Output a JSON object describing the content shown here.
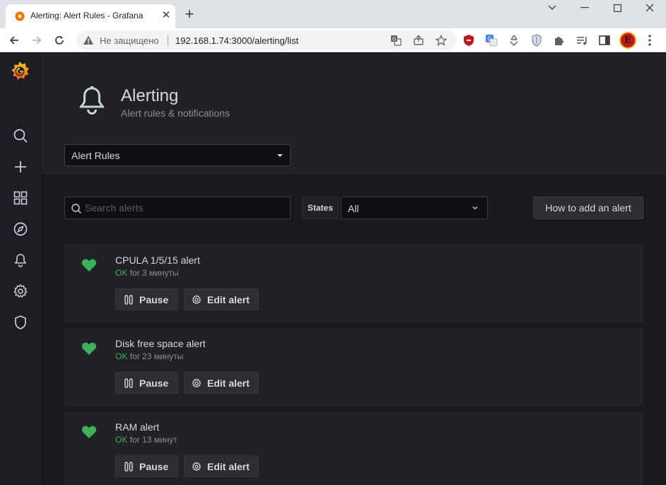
{
  "browser": {
    "tab_title": "Alerting: Alert Rules - Grafana",
    "security_label": "Не защищено",
    "url": "192.168.1.74:3000/alerting/list",
    "profile_initial": "E"
  },
  "grafana": {
    "page_title": "Alerting",
    "page_subtitle": "Alert rules & notifications",
    "view_select": "Alert Rules",
    "search_placeholder": "Search alerts",
    "states_label": "States",
    "states_value": "All",
    "howto_button": "How to add an alert",
    "alerts": [
      {
        "name": "CPULA 1/5/15 alert",
        "state": "OK",
        "duration": "for 3 минуты",
        "pause_label": "Pause",
        "edit_label": "Edit alert"
      },
      {
        "name": "Disk free space alert",
        "state": "OK",
        "duration": "for 23 минуты",
        "pause_label": "Pause",
        "edit_label": "Edit alert"
      },
      {
        "name": "RAM alert",
        "state": "OK",
        "duration": "for 13 минут",
        "pause_label": "Pause",
        "edit_label": "Edit alert"
      }
    ]
  },
  "colors": {
    "ok_green": "#3eb15b",
    "sidenav_bg": "#1d1e23",
    "panel_bg": "#202226",
    "text": "#d8d9da"
  },
  "icons": {
    "sidenav": [
      "search-icon",
      "plus-icon",
      "dashboards-icon",
      "explore-icon",
      "bell-icon",
      "gear-icon",
      "shield-icon"
    ]
  }
}
